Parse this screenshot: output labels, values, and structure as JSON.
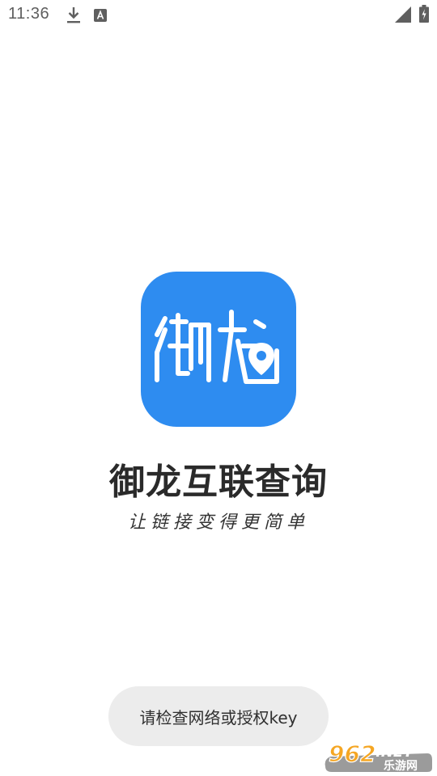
{
  "status_bar": {
    "time": "11:36",
    "icons": [
      "download-icon",
      "a-notification-icon",
      "signal-icon",
      "battery-charging-icon"
    ]
  },
  "app": {
    "icon_glyphs": "御龙",
    "name": "御龙互联查询",
    "slogan": "让链接变得更简单",
    "brand_color": "#2e8cf0"
  },
  "toast": {
    "message": "请检查网络或授权key"
  },
  "watermark": {
    "number": "962",
    "suffix": ".NET",
    "site": "乐游网"
  }
}
